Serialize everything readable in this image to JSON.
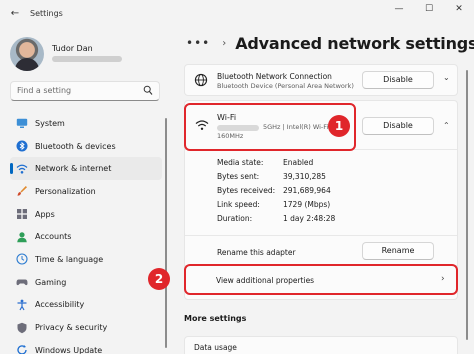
{
  "window": {
    "title": "Settings",
    "back_glyph": "←",
    "minimize_glyph": "—",
    "maximize_glyph": "☐",
    "close_glyph": "✕"
  },
  "profile": {
    "name": "Tudor Dan"
  },
  "search": {
    "placeholder": "Find a setting"
  },
  "sidebar": {
    "active_index": 2,
    "items": [
      {
        "label": "System",
        "icon": "monitor-icon"
      },
      {
        "label": "Bluetooth & devices",
        "icon": "bluetooth-icon"
      },
      {
        "label": "Network & internet",
        "icon": "wifi-icon"
      },
      {
        "label": "Personalization",
        "icon": "brush-icon"
      },
      {
        "label": "Apps",
        "icon": "apps-icon"
      },
      {
        "label": "Accounts",
        "icon": "person-icon"
      },
      {
        "label": "Time & language",
        "icon": "globe-clock-icon"
      },
      {
        "label": "Gaming",
        "icon": "gamepad-icon"
      },
      {
        "label": "Accessibility",
        "icon": "accessibility-icon"
      },
      {
        "label": "Privacy & security",
        "icon": "shield-icon"
      },
      {
        "label": "Windows Update",
        "icon": "update-icon"
      }
    ]
  },
  "header": {
    "dots": "•••",
    "chevron": "›",
    "title": "Advanced network settings"
  },
  "bluetooth_adapter": {
    "name": "Bluetooth Network Connection",
    "description": "Bluetooth Device (Personal Area Network)",
    "button_label": "Disable",
    "chevron": "⌄"
  },
  "wifi_adapter": {
    "name": "Wi-Fi",
    "description": "5GHz | Intel(R) Wi-Fi 6 A",
    "frequency": "160MHz",
    "button_label": "Disable",
    "chevron": "⌃",
    "properties": [
      {
        "label": "Media state:",
        "value": "Enabled"
      },
      {
        "label": "Bytes sent:",
        "value": "39,310,285"
      },
      {
        "label": "Bytes received:",
        "value": "291,689,964"
      },
      {
        "label": "Link speed:",
        "value": "1729 (Mbps)"
      },
      {
        "label": "Duration:",
        "value": "1 day 2:48:28"
      }
    ],
    "rename_label": "Rename this adapter",
    "rename_button": "Rename",
    "view_properties_label": "View additional properties",
    "view_chevron": "›"
  },
  "callouts": [
    "1",
    "2"
  ],
  "more_settings": {
    "heading": "More settings",
    "data_usage_label": "Data usage"
  },
  "colors": {
    "accent": "#0067c0",
    "callout": "#e0262b",
    "background": "#f3f3f3"
  }
}
